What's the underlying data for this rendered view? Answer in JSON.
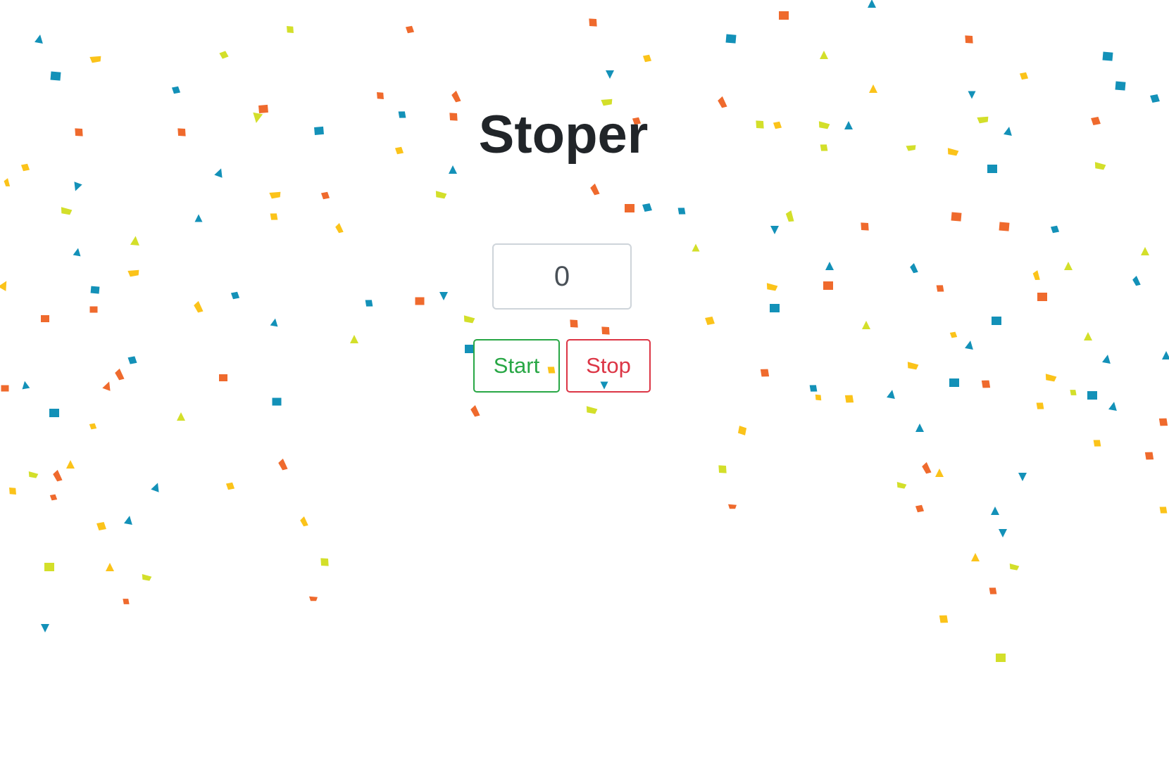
{
  "app": {
    "title": "Stoper"
  },
  "counter": {
    "value": "0"
  },
  "buttons": {
    "start_label": "Start",
    "stop_label": "Stop"
  },
  "colors": {
    "title": "#212529",
    "start_outline": "#28a745",
    "stop_outline": "#dc3545",
    "input_border": "#ced4da",
    "confetti": [
      "#ef6a2d",
      "#fbc31a",
      "#d3df2a",
      "#1391b8"
    ]
  }
}
